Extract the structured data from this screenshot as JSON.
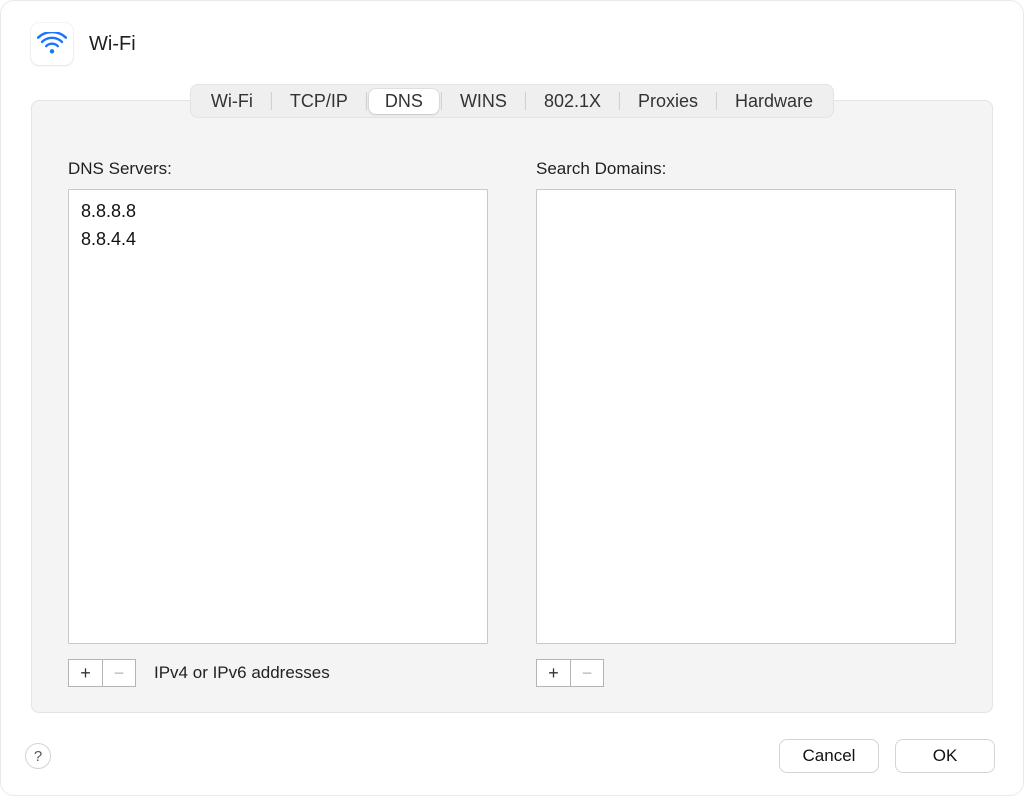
{
  "header": {
    "title": "Wi-Fi"
  },
  "tabs": {
    "items": [
      "Wi-Fi",
      "TCP/IP",
      "DNS",
      "WINS",
      "802.1X",
      "Proxies",
      "Hardware"
    ],
    "active_index": 2
  },
  "dns": {
    "servers_label": "DNS Servers:",
    "servers": [
      "8.8.8.8",
      "8.8.4.4"
    ],
    "hint": "IPv4 or IPv6 addresses",
    "search_domains_label": "Search Domains:",
    "search_domains": []
  },
  "buttons": {
    "help": "?",
    "cancel": "Cancel",
    "ok": "OK",
    "plus": "+",
    "minus": "−"
  }
}
